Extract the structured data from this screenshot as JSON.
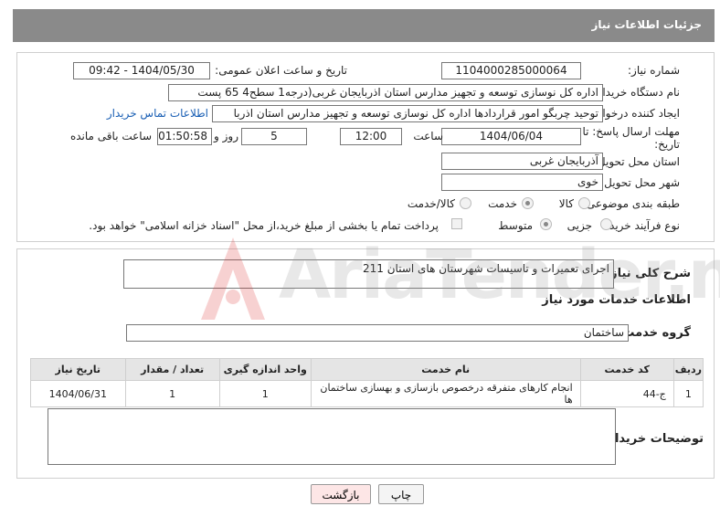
{
  "header": {
    "title": "جزئیات اطلاعات نیاز"
  },
  "form": {
    "need_number": {
      "label": "شماره نیاز:",
      "value": "1104000285000064"
    },
    "announce": {
      "label": "تاریخ و ساعت اعلان عمومی:",
      "value": "1404/05/30 - 09:42"
    },
    "buyer_org": {
      "label": "نام دستگاه خریدار:",
      "value": "اداره کل نوسازی   توسعه و تجهیز مدارس استان اذربایجان غربی(درجه1  سطح4  65 پست"
    },
    "creator": {
      "label": "ایجاد کننده درخواست:",
      "value": "توحید چربگو امور قراردادها اداره کل نوسازی   توسعه و تجهیز مدارس استان اذربا",
      "contact_link": "اطلاعات تماس خریدار"
    },
    "deadline": {
      "label1": "مهلت ارسال پاسخ: تا",
      "label2": "تاریخ:",
      "date": "1404/06/04",
      "time_label": "ساعت",
      "time": "12:00",
      "days": "5",
      "days_label": "روز و",
      "remaining": "01:50:58",
      "remaining_label": "ساعت باقی مانده"
    },
    "province": {
      "label": "استان محل تحویل:",
      "value": "آذربایجان غربی"
    },
    "city": {
      "label": "شهر محل تحویل:",
      "value": "خوی"
    },
    "category": {
      "label": "طبقه بندی موضوعی:",
      "options": [
        "کالا",
        "خدمت",
        "کالا/خدمت"
      ],
      "selected": 1
    },
    "purchase_type": {
      "label": "نوع فرآیند خرید :",
      "options": [
        "جزیی",
        "متوسط"
      ],
      "selected": 1,
      "note": "پرداخت تمام یا بخشی از مبلغ خرید،از محل \"اسناد خزانه اسلامی\" خواهد بود."
    }
  },
  "summary": {
    "label": "شرح کلی نیاز:",
    "value": "اجرای تعمیرات و تاسیسات شهرستان های استان 211"
  },
  "services": {
    "section_title": "اطلاعات خدمات مورد نیاز",
    "group_label": "گروه خدمت:",
    "group_value": "ساختمان",
    "columns": [
      "ردیف",
      "کد خدمت",
      "نام خدمت",
      "واحد اندازه گیری",
      "تعداد / مقدار",
      "تاریخ نیاز"
    ],
    "rows": [
      [
        "1",
        "ج-44",
        "انجام کارهای متفرقه درخصوص بازسازی و بهسازی ساختمان ها",
        "1",
        "1",
        "1404/06/31"
      ]
    ]
  },
  "buyer_notes": {
    "label": "توضیحات خریدار:",
    "value": ""
  },
  "buttons": {
    "print": "چاپ",
    "back": "بازگشت"
  },
  "watermark": {
    "text": "AriaTender.net"
  },
  "colors": {
    "header_bg": "#8a8a8a",
    "back_button_bg": "#fde6e6",
    "link": "#1a5fb4"
  }
}
